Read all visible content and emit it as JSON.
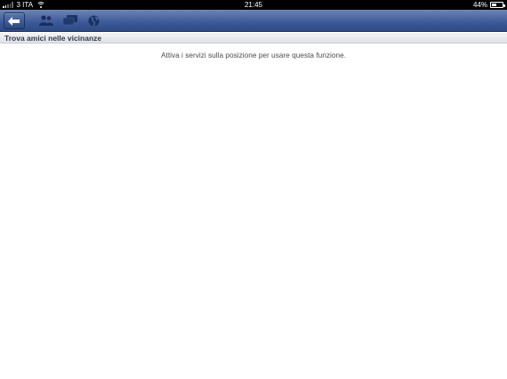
{
  "status_bar": {
    "carrier": "3 ITA",
    "time": "21:45",
    "battery_percent": "44%",
    "battery_level": 0.44
  },
  "nav_bar": {
    "icons": [
      "back-arrow-icon",
      "friends-icon",
      "messages-icon",
      "notifications-globe-icon"
    ],
    "color": "#3b5998"
  },
  "section": {
    "title": "Trova amici nelle vicinanze"
  },
  "content": {
    "message": "Attiva i servizi sulla posizione per usare questa funzione."
  }
}
